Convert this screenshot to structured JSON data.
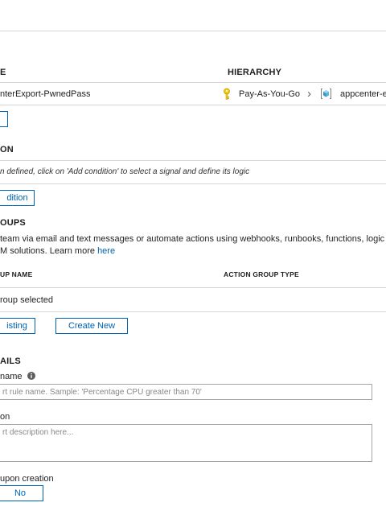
{
  "scope": {
    "col_resource": "E",
    "col_hierarchy": "HIERARCHY",
    "resource_name": "nterExport-PwnedPass",
    "subscription": "Pay-As-You-Go",
    "chevron": "›",
    "resource_group": "appcenter-e"
  },
  "condition": {
    "heading": "ON",
    "empty_text": "n defined, click on 'Add condition' to select a signal and define its logic",
    "add_button": "dition"
  },
  "action_groups": {
    "heading": "OUPS",
    "desc_line1_prefix": "team via email and text messages or automate actions using webhooks, runbooks, functions, logic",
    "desc_line2_prefix": "M solutions. Learn more ",
    "desc_link": "here",
    "col_name": "UP NAME",
    "col_type": "ACTION GROUP TYPE",
    "empty_text": "roup selected",
    "select_existing": "isting",
    "create_new": "Create New"
  },
  "details": {
    "heading": "AILS",
    "rule_name_label": " name",
    "rule_name_placeholder": "rt rule name. Sample: 'Percentage CPU greater than 70'",
    "description_label": "on",
    "description_placeholder": "rt description here...",
    "enable_label": " upon creation",
    "enable_value": "No"
  }
}
